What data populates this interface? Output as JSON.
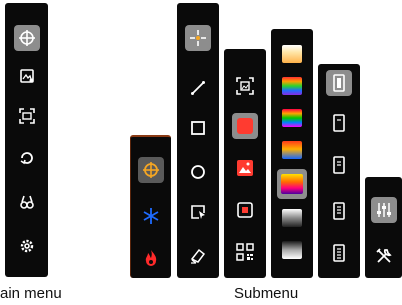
{
  "captions": {
    "main_menu": "ain menu",
    "submenu": "Submenu"
  },
  "main_menu": [
    {
      "icon": "crosshair-icon",
      "selected": true
    },
    {
      "icon": "image-edit-icon"
    },
    {
      "icon": "frame-capture-icon"
    },
    {
      "icon": "rotate-icon"
    },
    {
      "icon": "binoculars-icon"
    },
    {
      "icon": "settings-gear-icon"
    }
  ],
  "submenu_mode": [
    {
      "icon": "target-icon",
      "color": "#f5a623",
      "selected": true
    },
    {
      "icon": "snowflake-icon",
      "color": "#1f6bff"
    },
    {
      "icon": "flame-icon",
      "color": "#ff2a2a"
    }
  ],
  "submenu_measure": [
    {
      "icon": "point-crosshair-icon",
      "selected": true
    },
    {
      "icon": "line-icon"
    },
    {
      "icon": "rectangle-icon"
    },
    {
      "icon": "circle-icon"
    },
    {
      "icon": "cursor-box-icon"
    },
    {
      "icon": "eraser-icon"
    }
  ],
  "submenu_capture": [
    {
      "icon": "scan-photo-icon"
    },
    {
      "icon": "record-square-icon",
      "color": "#ff3b30",
      "selected": true
    },
    {
      "icon": "gallery-icon",
      "color": "#ff3b30"
    },
    {
      "icon": "stop-record-icon"
    },
    {
      "icon": "qr-code-icon"
    }
  ],
  "submenu_palette": [
    {
      "icon": "palette-white-hot",
      "selected": false
    },
    {
      "icon": "palette-rainbow",
      "selected": false
    },
    {
      "icon": "palette-rainbow-hc",
      "selected": false
    },
    {
      "icon": "palette-ironbow",
      "selected": false
    },
    {
      "icon": "palette-lava",
      "selected": true
    },
    {
      "icon": "palette-black-hot",
      "selected": false
    },
    {
      "icon": "palette-gray",
      "selected": false
    }
  ],
  "submenu_scale": [
    {
      "icon": "scale-full-icon",
      "selected": true
    },
    {
      "icon": "scale-1-icon"
    },
    {
      "icon": "scale-2-icon"
    },
    {
      "icon": "scale-3-icon"
    },
    {
      "icon": "scale-4-icon"
    }
  ],
  "submenu_tools": [
    {
      "icon": "sliders-icon",
      "selected": true
    },
    {
      "icon": "tools-icon"
    }
  ]
}
